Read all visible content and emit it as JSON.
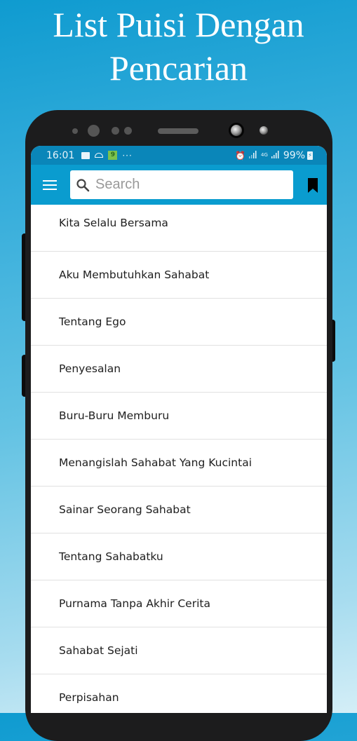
{
  "promo": {
    "title_line1": "List Puisi Dengan",
    "title_line2": "Pencarian"
  },
  "statusbar": {
    "time": "16:01",
    "left_icons": [
      "image-icon",
      "cloud-icon",
      "app-badge-icon",
      "more-dots-icon"
    ],
    "app_badge_text": "9",
    "dots": "···",
    "right_icons": [
      "alarm-icon",
      "signal-icon",
      "4g-icon",
      "signal-icon",
      "battery-charging-icon"
    ],
    "alarm": "⏰",
    "network": "4G",
    "battery": "99%"
  },
  "toolbar": {
    "menu_icon": "hamburger-menu-icon",
    "search_placeholder": "Search",
    "search_value": "",
    "bookmark_icon": "bookmark-icon"
  },
  "poems": [
    {
      "title": "Kita Selalu Bersama"
    },
    {
      "title": "Aku Membutuhkan Sahabat"
    },
    {
      "title": "Tentang Ego"
    },
    {
      "title": "Penyesalan"
    },
    {
      "title": "Buru-Buru Memburu"
    },
    {
      "title": "Menangislah Sahabat Yang Kucintai"
    },
    {
      "title": "Sainar Seorang Sahabat"
    },
    {
      "title": "Tentang Sahabatku"
    },
    {
      "title": "Purnama Tanpa Akhir Cerita"
    },
    {
      "title": "Sahabat Sejati"
    },
    {
      "title": "Perpisahan"
    }
  ],
  "colors": {
    "toolbar": "#0a9ccf",
    "statusbar": "#0a86b9",
    "phone_frame": "#1c1c1d",
    "divider": "#e1e1e1"
  }
}
